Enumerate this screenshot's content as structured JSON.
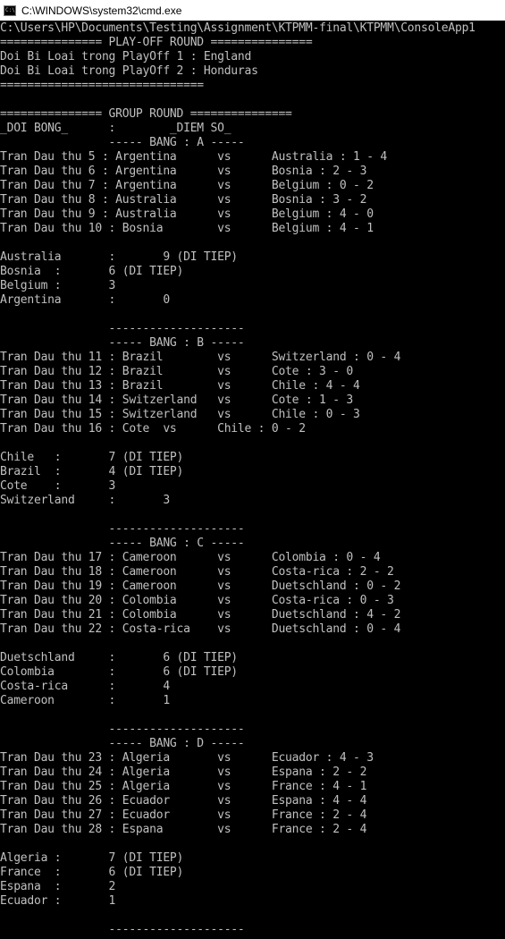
{
  "window": {
    "title": "C:\\WINDOWS\\system32\\cmd.exe",
    "app_icon_text": "C:\\"
  },
  "console": {
    "lines": [
      "C:\\Users\\HP\\Documents\\Testing\\Assignment\\KTPMM-final\\KTPMM\\ConsoleApp1",
      "=============== PLAY-OFF ROUND ===============",
      "Doi Bi Loai trong PlayOff 1 : England",
      "Doi Bi Loai trong PlayOff 2 : Honduras",
      "==============================",
      "",
      "=============== GROUP ROUND ===============",
      "_DOI BONG_      :        _DIEM SO_",
      "                ----- BANG : A -----",
      "Tran Dau thu 5 : Argentina      vs      Australia : 1 - 4",
      "Tran Dau thu 6 : Argentina      vs      Bosnia : 2 - 3",
      "Tran Dau thu 7 : Argentina      vs      Belgium : 0 - 2",
      "Tran Dau thu 8 : Australia      vs      Bosnia : 3 - 2",
      "Tran Dau thu 9 : Australia      vs      Belgium : 4 - 0",
      "Tran Dau thu 10 : Bosnia        vs      Belgium : 4 - 1",
      "",
      "Australia       :       9 (DI TIEP)",
      "Bosnia  :       6 (DI TIEP)",
      "Belgium :       3",
      "Argentina       :       0",
      "",
      "                --------------------",
      "                ----- BANG : B -----",
      "Tran Dau thu 11 : Brazil        vs      Switzerland : 0 - 4",
      "Tran Dau thu 12 : Brazil        vs      Cote : 3 - 0",
      "Tran Dau thu 13 : Brazil        vs      Chile : 4 - 4",
      "Tran Dau thu 14 : Switzerland   vs      Cote : 1 - 3",
      "Tran Dau thu 15 : Switzerland   vs      Chile : 0 - 3",
      "Tran Dau thu 16 : Cote  vs      Chile : 0 - 2",
      "",
      "Chile   :       7 (DI TIEP)",
      "Brazil  :       4 (DI TIEP)",
      "Cote    :       3",
      "Switzerland     :       3",
      "",
      "                --------------------",
      "                ----- BANG : C -----",
      "Tran Dau thu 17 : Cameroon      vs      Colombia : 0 - 4",
      "Tran Dau thu 18 : Cameroon      vs      Costa-rica : 2 - 2",
      "Tran Dau thu 19 : Cameroon      vs      Duetschland : 0 - 2",
      "Tran Dau thu 20 : Colombia      vs      Costa-rica : 0 - 3",
      "Tran Dau thu 21 : Colombia      vs      Duetschland : 4 - 2",
      "Tran Dau thu 22 : Costa-rica    vs      Duetschland : 0 - 4",
      "",
      "Duetschland     :       6 (DI TIEP)",
      "Colombia        :       6 (DI TIEP)",
      "Costa-rica      :       4",
      "Cameroon        :       1",
      "",
      "                --------------------",
      "                ----- BANG : D -----",
      "Tran Dau thu 23 : Algeria       vs      Ecuador : 4 - 3",
      "Tran Dau thu 24 : Algeria       vs      Espana : 2 - 2",
      "Tran Dau thu 25 : Algeria       vs      France : 4 - 1",
      "Tran Dau thu 26 : Ecuador       vs      Espana : 4 - 4",
      "Tran Dau thu 27 : Ecuador       vs      France : 2 - 4",
      "Tran Dau thu 28 : Espana        vs      France : 2 - 4",
      "",
      "Algeria :       7 (DI TIEP)",
      "France  :       6 (DI TIEP)",
      "Espana  :       2",
      "Ecuador :       1",
      "",
      "                --------------------"
    ]
  }
}
